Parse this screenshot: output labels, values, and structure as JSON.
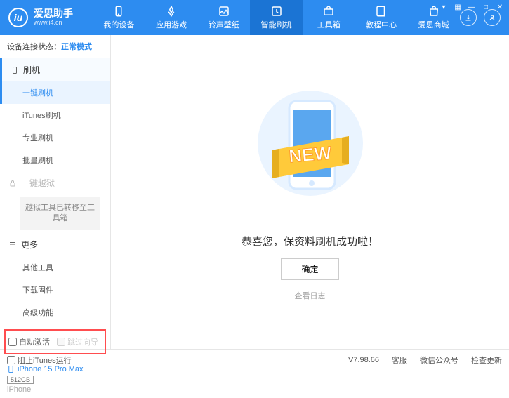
{
  "app": {
    "title": "爱思助手",
    "url": "www.i4.cn"
  },
  "nav": [
    {
      "label": "我的设备"
    },
    {
      "label": "应用游戏"
    },
    {
      "label": "铃声壁纸"
    },
    {
      "label": "智能刷机"
    },
    {
      "label": "工具箱"
    },
    {
      "label": "教程中心"
    },
    {
      "label": "爱思商城"
    }
  ],
  "status": {
    "prefix": "设备连接状态：",
    "mode": "正常模式"
  },
  "sidebar": {
    "flash": {
      "head": "刷机",
      "items": [
        "一键刷机",
        "iTunes刷机",
        "专业刷机",
        "批量刷机"
      ]
    },
    "jailbreak": {
      "head": "一键越狱",
      "note": "越狱工具已转移至工具箱"
    },
    "more": {
      "head": "更多",
      "items": [
        "其他工具",
        "下载固件",
        "高级功能"
      ]
    }
  },
  "checks": {
    "auto_activate": "自动激活",
    "skip_guide": "跳过向导"
  },
  "device": {
    "name": "iPhone 15 Pro Max",
    "storage": "512GB",
    "type": "iPhone"
  },
  "main": {
    "new_ribbon": "NEW",
    "message": "恭喜您，保资料刷机成功啦！",
    "ok": "确定",
    "log": "查看日志"
  },
  "footer": {
    "block_itunes": "阻止iTunes运行",
    "version": "V7.98.66",
    "support": "客服",
    "wechat": "微信公众号",
    "update": "检查更新"
  }
}
